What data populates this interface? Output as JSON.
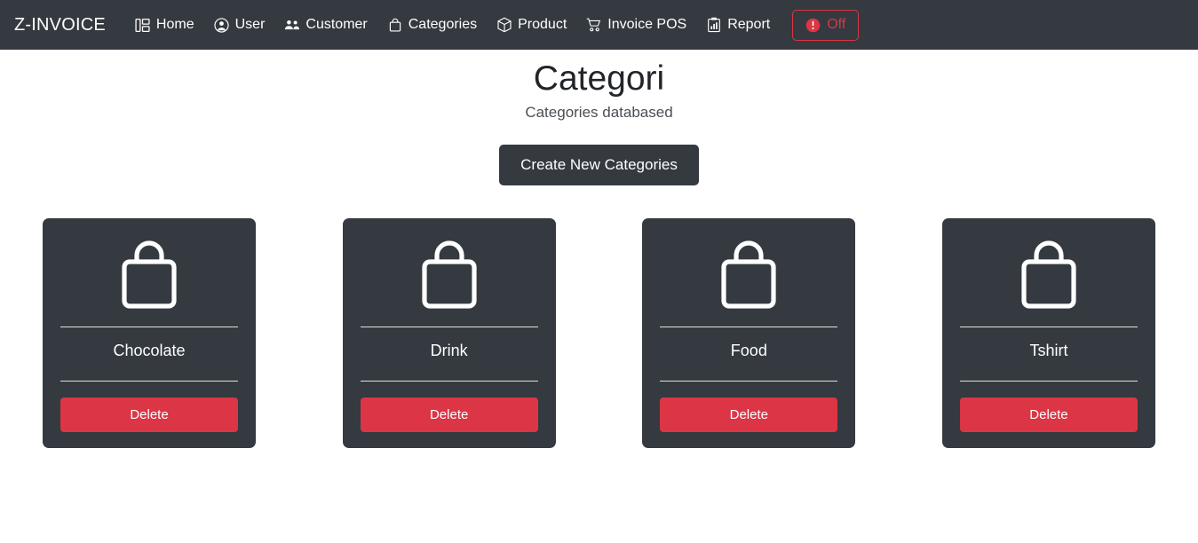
{
  "navbar": {
    "brand": "Z-INVOICE",
    "background_color": "#343a40",
    "links": [
      {
        "label": "Home",
        "icon": "layout-grid-icon"
      },
      {
        "label": "User",
        "icon": "user-circle-icon"
      },
      {
        "label": "Customer",
        "icon": "people-icon"
      },
      {
        "label": "Categories",
        "icon": "bag-icon"
      },
      {
        "label": "Product",
        "icon": "box-icon"
      },
      {
        "label": "Invoice POS",
        "icon": "cart-icon"
      },
      {
        "label": "Report",
        "icon": "clipboard-chart-icon"
      }
    ],
    "off_button": {
      "label": "Off",
      "icon": "exclamation-circle-icon",
      "color": "#dc3545"
    }
  },
  "header": {
    "title": "Categori",
    "subtitle": "Categories databased",
    "create_button": "Create New Categories"
  },
  "cards": [
    {
      "label": "Chocolate",
      "icon": "bag-icon",
      "delete_label": "Delete"
    },
    {
      "label": "Drink",
      "icon": "bag-icon",
      "delete_label": "Delete"
    },
    {
      "label": "Food",
      "icon": "bag-icon",
      "delete_label": "Delete"
    },
    {
      "label": "Tshirt",
      "icon": "bag-icon",
      "delete_label": "Delete"
    }
  ],
  "colors": {
    "dark": "#343a40",
    "danger": "#dc3545",
    "page_bg": "#ffffff",
    "text_light": "#ffffff"
  }
}
